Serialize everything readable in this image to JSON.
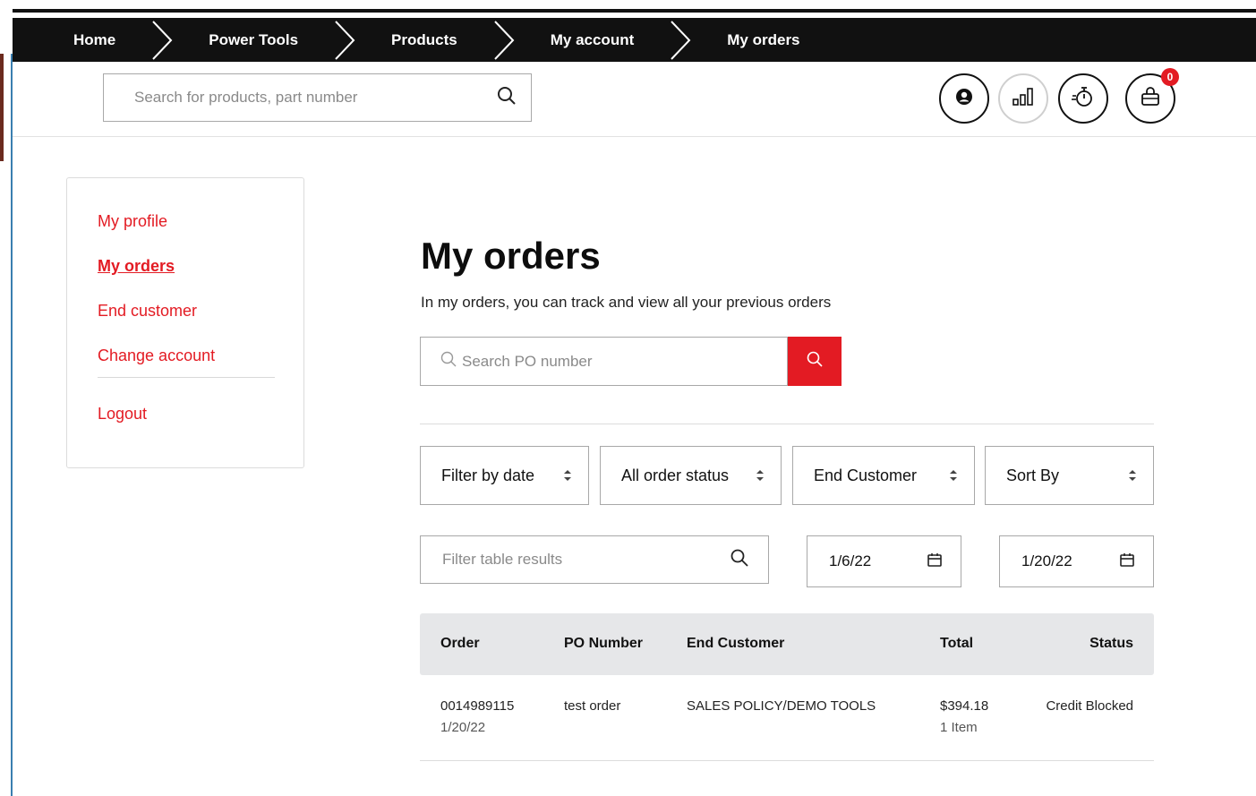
{
  "breadcrumb": [
    "Home",
    "Power Tools",
    "Products",
    "My account",
    "My orders"
  ],
  "header": {
    "search_placeholder": "Search for products, part number",
    "cart_count": "0"
  },
  "sidebar": {
    "items": [
      {
        "label": "My profile"
      },
      {
        "label": "My orders"
      },
      {
        "label": "End customer"
      },
      {
        "label": "Change account"
      },
      {
        "label": "Logout"
      }
    ],
    "active": "My orders"
  },
  "main": {
    "title": "My orders",
    "subtitle": "In my orders, you can track and view all your previous orders",
    "po_search_placeholder": "Search PO number",
    "filters": {
      "date": "Filter by date",
      "status": "All order status",
      "customer": "End Customer",
      "sort": "Sort By"
    },
    "table_filter_placeholder": "Filter table results",
    "date_from": "1/6/22",
    "date_to": "1/20/22",
    "table": {
      "columns": [
        "Order",
        "PO Number",
        "End Customer",
        "Total",
        "Status"
      ],
      "rows": [
        {
          "order": "0014989115",
          "order_date": "1/20/22",
          "po_number": "test order",
          "end_customer": "SALES POLICY/DEMO TOOLS",
          "total": "$394.18",
          "items": "1 Item",
          "status": "Credit Blocked"
        }
      ]
    }
  },
  "colors": {
    "accent": "#e31b23",
    "nav_bg": "#111111",
    "table_header_bg": "#e6e7e9"
  },
  "icons": [
    "search-icon",
    "account-icon",
    "compare-icon",
    "stopwatch-icon",
    "cart-icon",
    "calendar-icon",
    "sort-caret-icon"
  ]
}
